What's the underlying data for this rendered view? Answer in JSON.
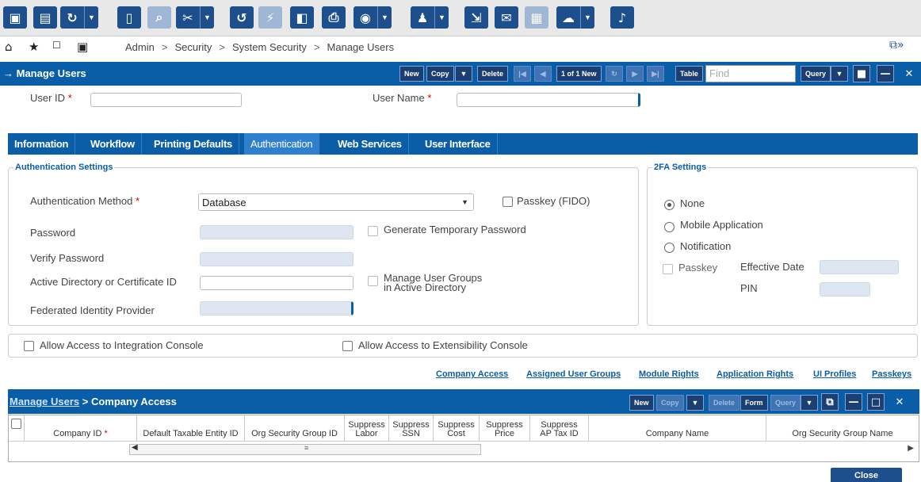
{
  "breadcrumb": [
    "Admin",
    "Security",
    "System Security",
    "Manage Users"
  ],
  "header": {
    "title": "Manage Users",
    "buttons": {
      "new": "New",
      "copy": "Copy",
      "delete": "Delete",
      "record_count": "1 of 1 New",
      "table": "Table",
      "query": "Query"
    },
    "find_placeholder": "Find"
  },
  "user_fields": {
    "user_id_label": "User ID",
    "user_id_value": "",
    "user_name_label": "User Name",
    "user_name_value": ""
  },
  "tabs": [
    "Information",
    "Workflow",
    "Printing Defaults",
    "Authentication",
    "Web Services",
    "User Interface"
  ],
  "active_tab": "Authentication",
  "auth": {
    "section_title": "Authentication Settings",
    "method_label": "Authentication Method",
    "method_value": "Database",
    "passkey_fido_label": "Passkey (FIDO)",
    "password_label": "Password",
    "gen_temp_pw_label": "Generate Temporary Password",
    "verify_pw_label": "Verify Password",
    "ad_cert_label": "Active Directory or Certificate ID",
    "manage_groups_label_1": "Manage User Groups",
    "manage_groups_label_2": "in Active Directory",
    "federated_label": "Federated Identity Provider"
  },
  "twofa": {
    "section_title": "2FA Settings",
    "options": [
      "None",
      "Mobile Application",
      "Notification"
    ],
    "selected": "None",
    "passkey_label": "Passkey",
    "effective_date_label": "Effective Date",
    "pin_label": "PIN"
  },
  "access": {
    "integration_console": "Allow Access to Integration Console",
    "extensibility_console": "Allow Access to Extensibility Console"
  },
  "links": [
    "Company Access",
    "Assigned User Groups",
    "Module Rights",
    "Application Rights",
    "UI Profiles",
    "Passkeys"
  ],
  "company_access": {
    "parent_link": "Manage Users",
    "title": " > Company Access",
    "buttons": {
      "new": "New",
      "copy": "Copy",
      "delete": "Delete",
      "form": "Form",
      "query": "Query"
    },
    "columns": {
      "company_id": "Company ID",
      "default_tax": "Default Taxable Entity ID",
      "org_sec_group": "Org Security Group ID",
      "sup_labor_1": "Suppress",
      "sup_labor_2": "Labor",
      "sup_ssn_1": "Suppress",
      "sup_ssn_2": "SSN",
      "sup_cost_1": "Suppress",
      "sup_cost_2": "Cost",
      "sup_price_1": "Suppress",
      "sup_price_2": "Price",
      "sup_ap_1": "Suppress",
      "sup_ap_2": "AP Tax ID",
      "company_name": "Company Name",
      "org_sec_group_name": "Org Security Group Name"
    }
  },
  "close_label": "Close"
}
